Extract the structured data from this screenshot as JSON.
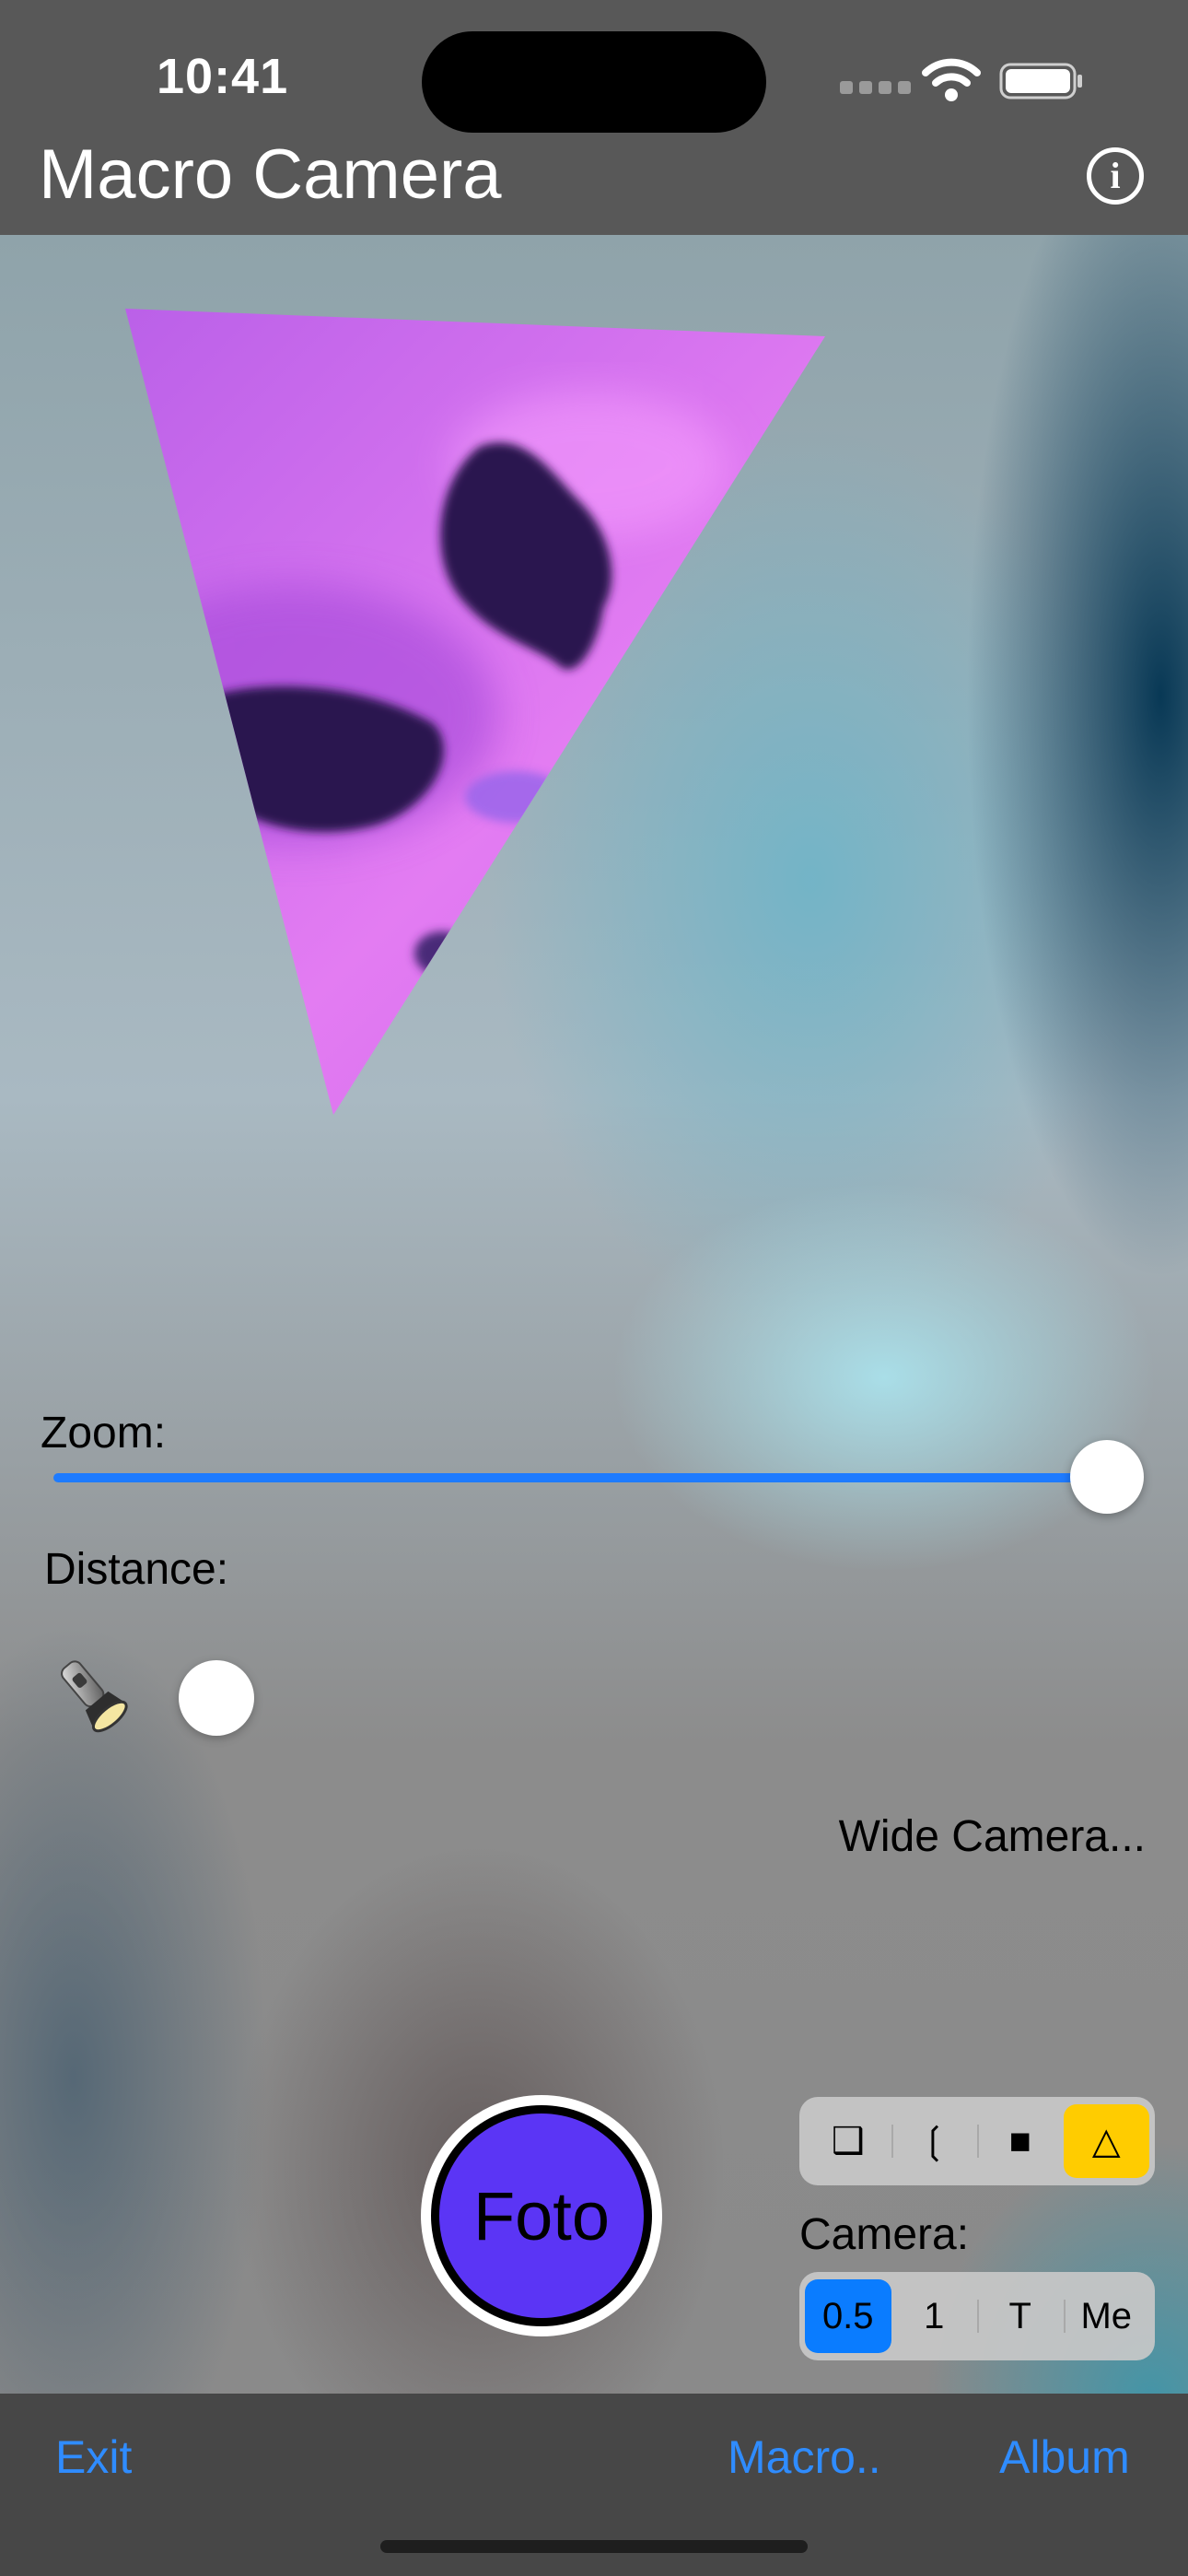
{
  "status_bar": {
    "time": "10:41"
  },
  "nav": {
    "title": "Macro Camera",
    "info_icon": "info-icon",
    "info_glyph": "i"
  },
  "controls": {
    "zoom_label": "Zoom:",
    "zoom_value_fraction": 1.0,
    "distance_label": "Distance:",
    "distance_value_fraction": 0.0,
    "flashlight_icon": "flashlight-icon",
    "camera_status": "Wide Camera...",
    "shutter_label": "Foto",
    "shape_options": [
      {
        "label": "❑",
        "icon": "square-shadow-icon"
      },
      {
        "label": "❲",
        "icon": "circle-shadow-icon"
      },
      {
        "label": "■",
        "icon": "square-icon"
      },
      {
        "label": "△",
        "icon": "triangle-icon"
      }
    ],
    "shape_selected_index": 3,
    "camera_label": "Camera:",
    "camera_options": [
      "0.5",
      "1",
      "T",
      "Me"
    ],
    "camera_selected_index": 0
  },
  "toolbar": {
    "exit": "Exit",
    "macro": "Macro..",
    "album": "Album"
  },
  "colors": {
    "accent_blue": "#1e7bff",
    "shape_selected": "#ffcc00",
    "shutter_fill": "#5b35f5",
    "bar_background": "#585858",
    "toolbar_background": "#474747"
  }
}
